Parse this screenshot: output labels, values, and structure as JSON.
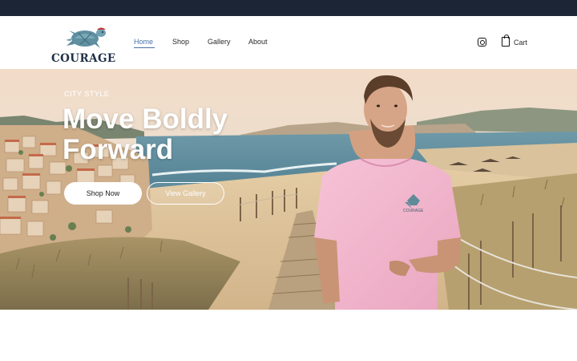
{
  "brand": {
    "name": "COURAGE",
    "logo_icon": "sea-turtle-logo"
  },
  "nav": {
    "items": [
      {
        "label": "Home",
        "active": true
      },
      {
        "label": "Shop"
      },
      {
        "label": "Gallery"
      },
      {
        "label": "About"
      }
    ]
  },
  "header_actions": {
    "instagram_icon": "instagram-icon",
    "cart_icon": "shopping-bag-icon",
    "cart_label": "Cart"
  },
  "hero": {
    "eyebrow": "CITY STYLE",
    "headline_line1": "Move Boldly",
    "headline_line2": "Forward",
    "shirt_print": "COURAGE",
    "primary_button": "Shop Now",
    "secondary_button": "View Gallery"
  },
  "colors": {
    "topbar": "#1c2536",
    "accent": "#4a72a8",
    "shirt": "#f3b6ce"
  }
}
